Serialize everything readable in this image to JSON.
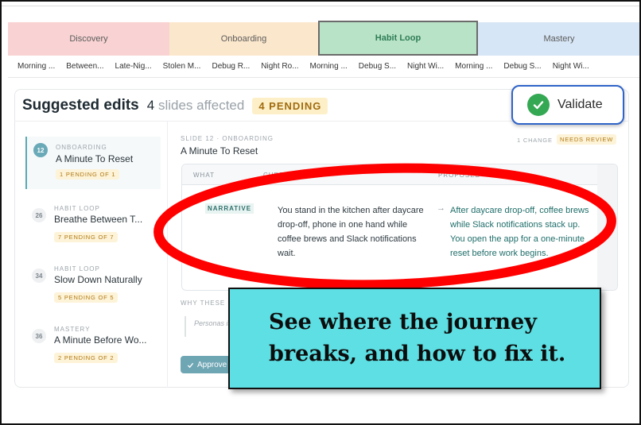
{
  "phases": [
    "Discovery",
    "Onboarding",
    "Habit Loop",
    "Mastery"
  ],
  "slide_chips": [
    "Morning ...",
    "Between...",
    "Late-Nig...",
    "Stolen M...",
    "Debug R...",
    "Night Ro...",
    "Morning ...",
    "Debug S...",
    "Night Wi...",
    "Morning ...",
    "Debug S...",
    "Night Wi..."
  ],
  "header": {
    "title": "Suggested edits",
    "affected_count": "4",
    "affected_text": "slides affected",
    "pending_badge": "4 PENDING",
    "validate_label": "Validate"
  },
  "edits": [
    {
      "num": "12",
      "phase": "ONBOARDING",
      "name": "A Minute To Reset",
      "pending": "1 PENDING OF 1"
    },
    {
      "num": "26",
      "phase": "HABIT LOOP",
      "name": "Breathe Between T...",
      "pending": "7 PENDING OF 7"
    },
    {
      "num": "34",
      "phase": "HABIT LOOP",
      "name": "Slow Down Naturally",
      "pending": "5 PENDING OF 5"
    },
    {
      "num": "36",
      "phase": "MASTERY",
      "name": "A Minute Before Wo...",
      "pending": "2 PENDING OF 2"
    }
  ],
  "detail": {
    "slide_meta": "SLIDE 12 · ONBOARDING",
    "slide_title": "A Minute To Reset",
    "change_count": "1 CHANGE",
    "status": "NEEDS REVIEW",
    "columns": [
      "WHAT",
      "CURRENTLY",
      "PROPOSED"
    ],
    "row": {
      "type": "NARRATIVE",
      "current": "You stand in the kitchen after daycare drop-off, phone in one hand while coffee brews and Slack notifications wait.",
      "arrow": "→",
      "proposed": "After daycare drop-off, coffee brews while Slack notifications stack up. You open the app for a one-minute reset before work begins."
    },
    "why_label": "WHY THESE",
    "why_body": "Personas intent cla",
    "approve_label": "Approve"
  },
  "callout": {
    "line1": "See where the journey",
    "line2": "breaks, and how to fix it."
  },
  "colors": {
    "highlight_ellipse": "#ff0000",
    "callout_bg": "#5ddfe3",
    "validate_border": "#2f64c8",
    "accent_teal": "#1f6e6a"
  }
}
